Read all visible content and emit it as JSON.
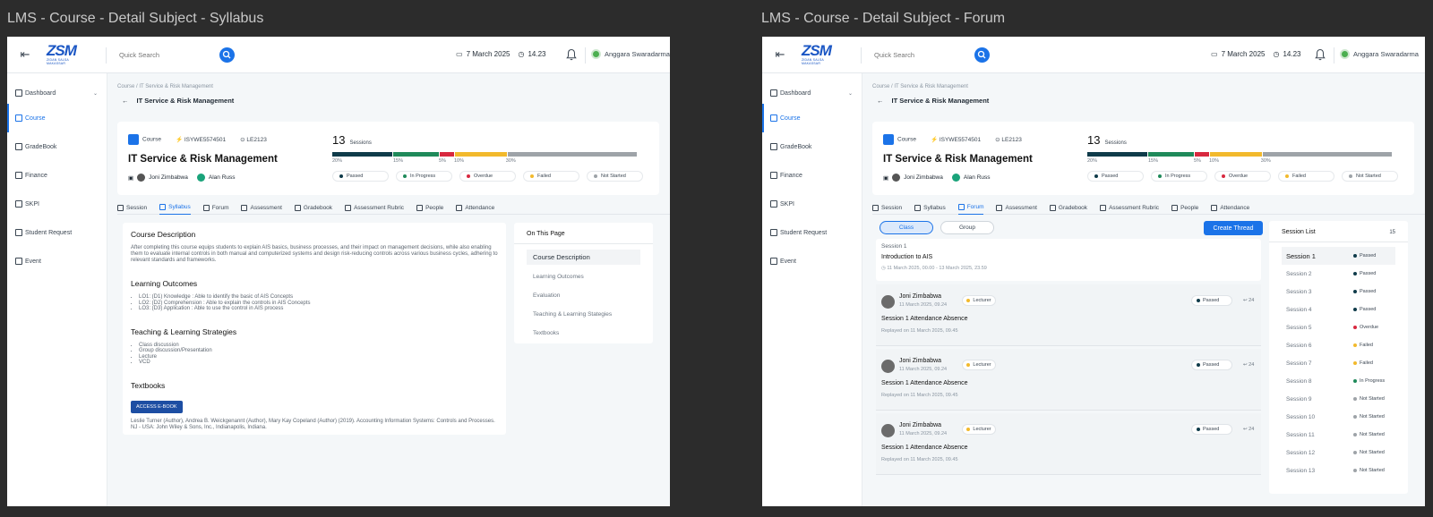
{
  "frames": [
    {
      "title": "LMS - Course - Detail Subject - Syllabus"
    },
    {
      "title": "LMS - Course - Detail Subject - Forum"
    }
  ],
  "topbar": {
    "logo": "ZSM",
    "logo_sub": "ZIDAN SALSA MAKASSAR",
    "search_placeholder": "Quick Search",
    "date": "7 March 2025",
    "time": "14.23",
    "user": "Anggara Swaradarma"
  },
  "sidebar": {
    "items": [
      {
        "label": "Dashboard"
      },
      {
        "label": "Course"
      },
      {
        "label": "GradeBook"
      },
      {
        "label": "Finance"
      },
      {
        "label": "SKPI"
      },
      {
        "label": "Student Request"
      },
      {
        "label": "Event"
      }
    ]
  },
  "breadcrumb": "Course / IT Service & Risk Management",
  "page_title": "IT Service & Risk Management",
  "course": {
    "type": "Course",
    "code": "ISYWE5574501",
    "room": "LE2123",
    "title": "IT Service & Risk Management",
    "lecturer1": "Joni Zimbabwa",
    "lecturer2": "Alan Russ",
    "sessions_count": "13",
    "sessions_label": "Sessions",
    "progress": [
      {
        "label": "Passed",
        "pct": "20%",
        "value": 20,
        "color": "#0f3b4a"
      },
      {
        "label": "In Progress",
        "pct": "15%",
        "value": 15,
        "color": "#1f8a5a"
      },
      {
        "label": "Overdue",
        "pct": "5%",
        "value": 5,
        "color": "#d8283f"
      },
      {
        "label": "Failed",
        "pct": "10%",
        "value": 17,
        "color": "#f2b92c"
      },
      {
        "label": "Not Started",
        "pct": "30%",
        "value": 43,
        "color": "#9ea3a8"
      }
    ]
  },
  "tabs": [
    {
      "label": "Session"
    },
    {
      "label": "Syllabus"
    },
    {
      "label": "Forum"
    },
    {
      "label": "Assessment"
    },
    {
      "label": "Gradebook"
    },
    {
      "label": "Assessment Rubric"
    },
    {
      "label": "People"
    },
    {
      "label": "Attendance"
    }
  ],
  "syllabus": {
    "desc_h": "Course Description",
    "desc_p": "After completing this course equips students to explain AIS basics, business processes, and their impact on management decisions, while also enabling them to evaluate internal controls in both manual and computerized systems and design risk-reducing controls across various business cycles, adhering to relevant standards and frameworks.",
    "lo_h": "Learning Outcomes",
    "lo": [
      "LO1: (D1) Knowledge : Able to identify the basic of AIS Concepts",
      "LO2: (D2) Comprehension : Able to explain the controls in AIS Concepts",
      "LO3: (D3) Application : Able to use the control in AIS process"
    ],
    "tl_h": "Teaching & Learning Strategies",
    "tl": [
      "Class discussion",
      "Group discussion/Presentation",
      "Lecture",
      "VCD"
    ],
    "tb_h": "Textbooks",
    "ebook": "ACCESS E-BOOK",
    "tb_p": "Leslie Turner (Author), Andrea B. Weickgenannt (Author), Mary Kay Copeland (Author) (2019). Accounting Information Systems: Controls and Processes. NJ - USA: John Wiley & Sons, Inc., Indianapolis, Indiana."
  },
  "onpage": {
    "title": "On This Page",
    "items": [
      "Course Description",
      "Learning Outcomes",
      "Evaluation",
      "Teaching & Learning Stategies",
      "Textbooks"
    ]
  },
  "forum": {
    "seg_class": "Class",
    "seg_group": "Group",
    "create": "Create Thread",
    "session": {
      "label": "Session 1",
      "title": "Introduction to AIS",
      "dates": "11 March 2025, 00.00  -  13 March 2025, 23.59"
    },
    "threads": [
      {
        "name": "Joni Zimbabwa",
        "date": "11 March 2025, 09.24",
        "role": "Lecturer",
        "status": "Passed",
        "replies": "24",
        "subject": "Session 1 Attendance Absence",
        "replied": "Replayed on 11 March 2025, 09.45"
      },
      {
        "name": "Joni Zimbabwa",
        "date": "11 March 2025, 09.24",
        "role": "Lecturer",
        "status": "Passed",
        "replies": "24",
        "subject": "Session 1 Attendance Absence",
        "replied": "Replayed on 11 March 2025, 09.45"
      },
      {
        "name": "Joni Zimbabwa",
        "date": "11 March 2025, 09.24",
        "role": "Lecturer",
        "status": "Passed",
        "replies": "24",
        "subject": "Session 1 Attendance Absence",
        "replied": "Replayed on 11 March 2025, 09.45"
      }
    ],
    "session_list": {
      "title": "Session List",
      "count": "15",
      "items": [
        {
          "label": "Session 1",
          "status": "Passed",
          "color": "#0f3b4a"
        },
        {
          "label": "Session 2",
          "status": "Passed",
          "color": "#0f3b4a"
        },
        {
          "label": "Session 3",
          "status": "Passed",
          "color": "#0f3b4a"
        },
        {
          "label": "Session 4",
          "status": "Passed",
          "color": "#0f3b4a"
        },
        {
          "label": "Session 5",
          "status": "Overdue",
          "color": "#d8283f"
        },
        {
          "label": "Session 6",
          "status": "Failed",
          "color": "#f2b92c"
        },
        {
          "label": "Session 7",
          "status": "Failed",
          "color": "#f2b92c"
        },
        {
          "label": "Session 8",
          "status": "In Progress",
          "color": "#1f8a5a"
        },
        {
          "label": "Session 9",
          "status": "Not Started",
          "color": "#9ea3a8"
        },
        {
          "label": "Session 10",
          "status": "Not Started",
          "color": "#9ea3a8"
        },
        {
          "label": "Session 11",
          "status": "Not Started",
          "color": "#9ea3a8"
        },
        {
          "label": "Session 12",
          "status": "Not Started",
          "color": "#9ea3a8"
        },
        {
          "label": "Session 13",
          "status": "Not Started",
          "color": "#9ea3a8"
        }
      ]
    }
  }
}
